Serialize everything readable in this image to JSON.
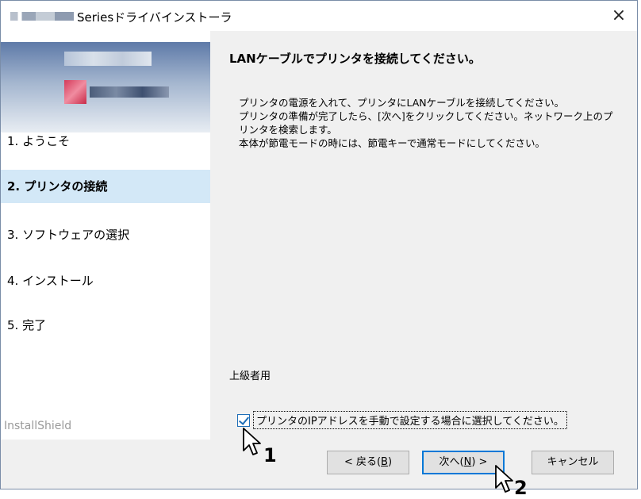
{
  "window": {
    "title": "Seriesドライバインストーラ",
    "close_symbol": "×"
  },
  "sidebar": {
    "steps": [
      {
        "label": "1. ようこそ"
      },
      {
        "label": "2. プリンタの接続"
      },
      {
        "label": "3. ソフトウェアの選択"
      },
      {
        "label": "4. インストール"
      },
      {
        "label": "5. 完了"
      }
    ],
    "active_step": 2,
    "brand": "InstallShield"
  },
  "content": {
    "heading": "LANケーブルでプリンタを接続してください。",
    "description": [
      "プリンタの電源を入れて、プリンタにLANケーブルを接続してください。",
      "プリンタの準備が完了したら、[次へ]をクリックしてください。ネットワーク上のプ",
      "リンタを検索します。",
      "本体が節電モードの時には、節電キーで通常モードにしてください。"
    ],
    "advanced_label": "上級者用",
    "manual_ip_checkbox": {
      "label": "プリンタのIPアドレスを手動で設定する場合に選択してください。",
      "checked": true
    }
  },
  "buttons": {
    "back": {
      "label": "< 戻る(",
      "mnemonic": "B",
      "suffix": ")"
    },
    "next": {
      "label": "次へ(",
      "mnemonic": "N",
      "suffix": ") >"
    },
    "cancel": {
      "label": "キャンセル"
    }
  },
  "annotations": {
    "callout_1": "1",
    "callout_2": "2"
  },
  "colors": {
    "active_step_bg": "#d3e8f7",
    "accent": "#0078d7"
  }
}
